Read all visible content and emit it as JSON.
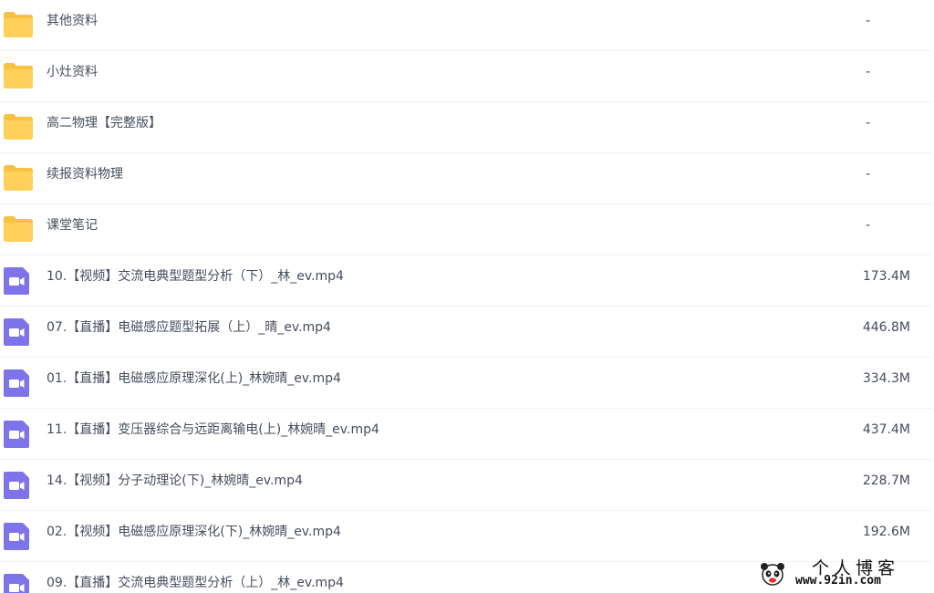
{
  "colors": {
    "folder": "#ffd15a",
    "folder_tab": "#f7c142",
    "video_icon": "#7c74e8",
    "text": "#454d5a",
    "divider": "#f1f2f4"
  },
  "files": [
    {
      "type": "folder",
      "icon": "folder-icon",
      "name": "其他资料",
      "size": "-"
    },
    {
      "type": "folder",
      "icon": "folder-icon",
      "name": "小灶资料",
      "size": "-"
    },
    {
      "type": "folder",
      "icon": "folder-icon",
      "name": "高二物理【完整版】",
      "size": "-"
    },
    {
      "type": "folder",
      "icon": "folder-icon",
      "name": "续报资料物理",
      "size": "-"
    },
    {
      "type": "folder",
      "icon": "folder-icon",
      "name": "课堂笔记",
      "size": "-"
    },
    {
      "type": "video",
      "icon": "video-file-icon",
      "name": "10.【视频】交流电典型题型分析（下）_林_ev.mp4",
      "size": "173.4M"
    },
    {
      "type": "video",
      "icon": "video-file-icon",
      "name": "07.【直播】电磁感应题型拓展（上）_晴_ev.mp4",
      "size": "446.8M"
    },
    {
      "type": "video",
      "icon": "video-file-icon",
      "name": "01.【直播】电磁感应原理深化(上)_林婉晴_ev.mp4",
      "size": "334.3M"
    },
    {
      "type": "video",
      "icon": "video-file-icon",
      "name": "11.【直播】变压器综合与远距离输电(上)_林婉晴_ev.mp4",
      "size": "437.4M"
    },
    {
      "type": "video",
      "icon": "video-file-icon",
      "name": "14.【视频】分子动理论(下)_林婉晴_ev.mp4",
      "size": "228.7M"
    },
    {
      "type": "video",
      "icon": "video-file-icon",
      "name": "02.【视频】电磁感应原理深化(下)_林婉晴_ev.mp4",
      "size": "192.6M"
    },
    {
      "type": "video",
      "icon": "video-file-icon",
      "name": "09.【直播】交流电典型题型分析（上）_林_ev.mp4",
      "size": ""
    }
  ],
  "watermark": {
    "title": "个人博客",
    "url": "www.92in.com",
    "logo_icon": "panda-logo-icon"
  }
}
